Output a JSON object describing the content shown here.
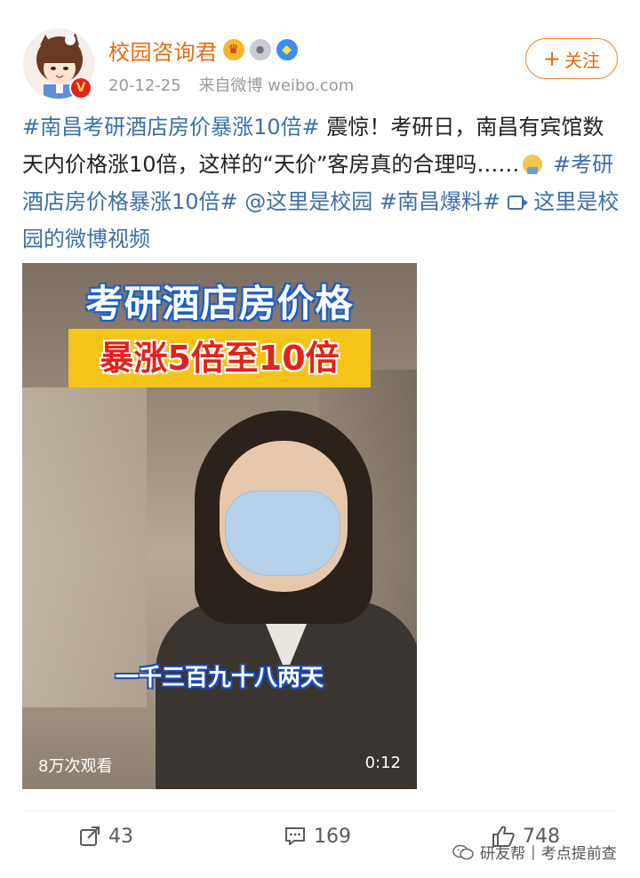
{
  "header": {
    "user_name": "校园咨询君",
    "date": "20-12-25",
    "source": "来自微博 weibo.com",
    "follow_label": "关注",
    "follow_plus": "+",
    "verified_badge": "V"
  },
  "post": {
    "tag1": "#南昌考研酒店房价暴涨10倍#",
    "text1": " 震惊！考研日，南昌有宾馆数天内价格涨10倍，这样的“天价”客房真的合理吗……",
    "tag2": " #考研酒店房价格暴涨10倍#",
    "mention": " @这里是校园",
    "tag3": " #南昌爆料#",
    "link_text": " 这里是校园的微博视频"
  },
  "video": {
    "title_line1": "考研酒店房价格",
    "title_line2": "暴涨5倍至10倍",
    "subtitle": "一千三百九十八两天",
    "views": "8万次观看",
    "duration": "0:12"
  },
  "actions": {
    "share_count": "43",
    "comment_count": "169",
    "like_count": "748"
  },
  "watermark": {
    "name": "研友帮",
    "separator": "|",
    "slogan": "考点提前查"
  },
  "colors": {
    "username_orange": "#e86a10",
    "link_blue": "#3e6fa8",
    "title_yellow": "#f5c419",
    "title_red": "#e2231a"
  }
}
